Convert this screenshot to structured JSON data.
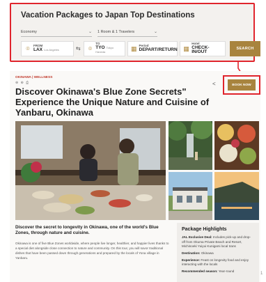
{
  "search": {
    "title": "Vacation Packages to Japan Top Destinations",
    "cabin": "Economy",
    "passengers": "1 Room & 1 Travelers",
    "from_label": "FROM",
    "from_code": "LAX",
    "from_city": "Los Angeles",
    "to_label": "TO",
    "to_code": "TYO",
    "to_city": "Tokyo Haneda",
    "dep_label": "Period",
    "dep_value": "DEPART/RETURN",
    "hotel_label": "Hotel",
    "hotel_value": "CHECK-IN/OUT",
    "search_button": "SEARCH"
  },
  "article": {
    "categories": "OKINAWA | WELLNESS",
    "meta_icons": "⊕ ⊕ ⎙",
    "title": "Discover Okinawa's Blue Zone Secrets\" Experience the Unique Nature and Cuisine of Yanbaru, Okinawa",
    "book_button": "BOOK NOW",
    "intro_lead": "Discover the secret to longevity in Okinawa, one of the world's Blue Zones, through nature and cuisine.",
    "intro_body": "Okinawa is one of five Blue Zones worldwide, where people live longer, healthier, and happier lives thanks to a special diet alongside close connection to nature and community. On this tour, you will savor traditional dishes that have been passed down through generations and prepared by the locals of Yona village in Yanbaru."
  },
  "highlights": {
    "title": "Package Highlights",
    "items": [
      {
        "label": "JAL Exclusive Deal:",
        "text": "Includes pick-up and drop-off from Okuma Private Beach and Resort, Michinoeki Yuiyui Kunigami local trans"
      },
      {
        "label": "Destination:",
        "text": "Okinawa"
      },
      {
        "label": "Experience:",
        "text": "Feast on longevity food and enjoy interacting with the locals"
      },
      {
        "label": "Recommended season:",
        "text": "Year-round"
      }
    ]
  },
  "corner_mark": "1",
  "colors": {
    "accent_red": "#e0242c",
    "gold": "#a8843e"
  }
}
